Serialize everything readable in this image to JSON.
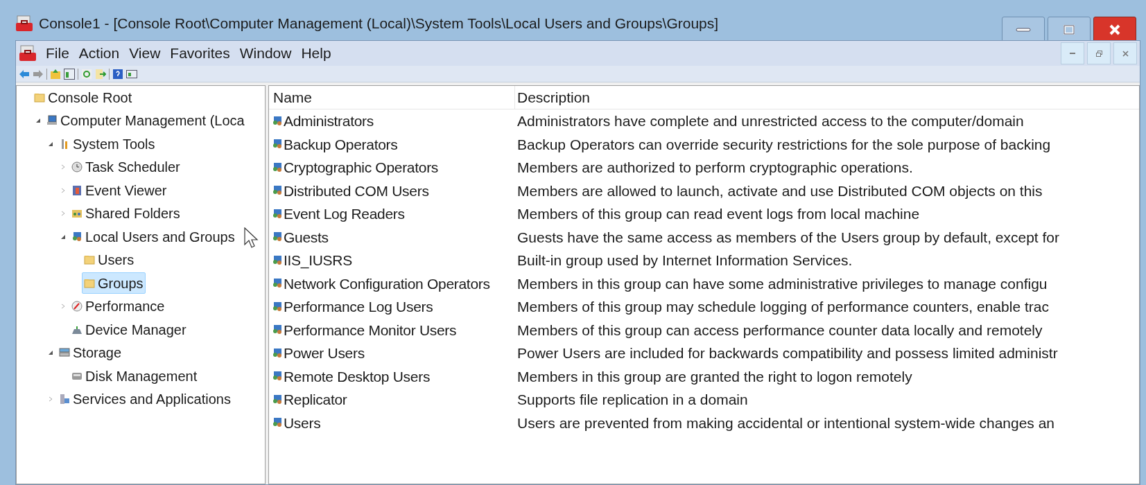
{
  "window": {
    "title": "Console1 - [Console Root\\Computer Management (Local)\\System Tools\\Local Users and Groups\\Groups]"
  },
  "menu": [
    "File",
    "Action",
    "View",
    "Favorites",
    "Window",
    "Help"
  ],
  "tree": [
    {
      "label": "Console Root",
      "kind": "folder",
      "selected": false,
      "children": [
        {
          "label": "Computer Management (Loca",
          "kind": "computer",
          "selected": false,
          "expanded": true,
          "children": [
            {
              "label": "System Tools",
              "kind": "tools",
              "selected": false,
              "expanded": true,
              "children": [
                {
                  "label": "Task Scheduler",
                  "kind": "clock",
                  "selected": false,
                  "expanded": false
                },
                {
                  "label": "Event Viewer",
                  "kind": "log",
                  "selected": false,
                  "expanded": false
                },
                {
                  "label": "Shared Folders",
                  "kind": "share",
                  "selected": false,
                  "expanded": false
                },
                {
                  "label": "Local Users and Groups",
                  "kind": "users",
                  "selected": false,
                  "expanded": true,
                  "children": [
                    {
                      "label": "Users",
                      "kind": "folder",
                      "selected": false
                    },
                    {
                      "label": "Groups",
                      "kind": "folder",
                      "selected": true
                    }
                  ]
                },
                {
                  "label": "Performance",
                  "kind": "gauge",
                  "selected": false,
                  "expanded": false
                },
                {
                  "label": "Device Manager",
                  "kind": "device",
                  "selected": false
                }
              ]
            },
            {
              "label": "Storage",
              "kind": "storage",
              "selected": false,
              "expanded": true,
              "children": [
                {
                  "label": "Disk Management",
                  "kind": "disk",
                  "selected": false
                }
              ]
            },
            {
              "label": "Services and Applications",
              "kind": "services",
              "selected": false,
              "expanded": false
            }
          ]
        }
      ]
    }
  ],
  "table": {
    "columns": [
      "Name",
      "Description"
    ],
    "rows": [
      {
        "name": "Administrators",
        "description": "Administrators have complete and unrestricted access to the computer/domain"
      },
      {
        "name": "Backup Operators",
        "description": "Backup Operators can override security restrictions for the sole purpose of backing"
      },
      {
        "name": "Cryptographic Operators",
        "description": "Members are authorized to perform cryptographic operations."
      },
      {
        "name": "Distributed COM Users",
        "description": "Members are allowed to launch, activate and use Distributed COM objects on this"
      },
      {
        "name": "Event Log Readers",
        "description": "Members of this group can read event logs from local machine"
      },
      {
        "name": "Guests",
        "description": "Guests have the same access as members of the Users group by default, except for"
      },
      {
        "name": "IIS_IUSRS",
        "description": "Built-in group used by Internet Information Services."
      },
      {
        "name": "Network Configuration Operators",
        "description": "Members in this group can have some administrative privileges to manage configu"
      },
      {
        "name": "Performance Log Users",
        "description": "Members of this group may schedule logging of performance counters, enable trac"
      },
      {
        "name": "Performance Monitor Users",
        "description": "Members of this group can access performance counter data locally and remotely"
      },
      {
        "name": "Power Users",
        "description": "Power Users are included for backwards compatibility and possess limited administr"
      },
      {
        "name": "Remote Desktop Users",
        "description": "Members in this group are granted the right to logon remotely"
      },
      {
        "name": "Replicator",
        "description": "Supports file replication in a domain"
      },
      {
        "name": "Users",
        "description": "Users are prevented from making accidental or intentional system-wide changes an"
      }
    ]
  }
}
